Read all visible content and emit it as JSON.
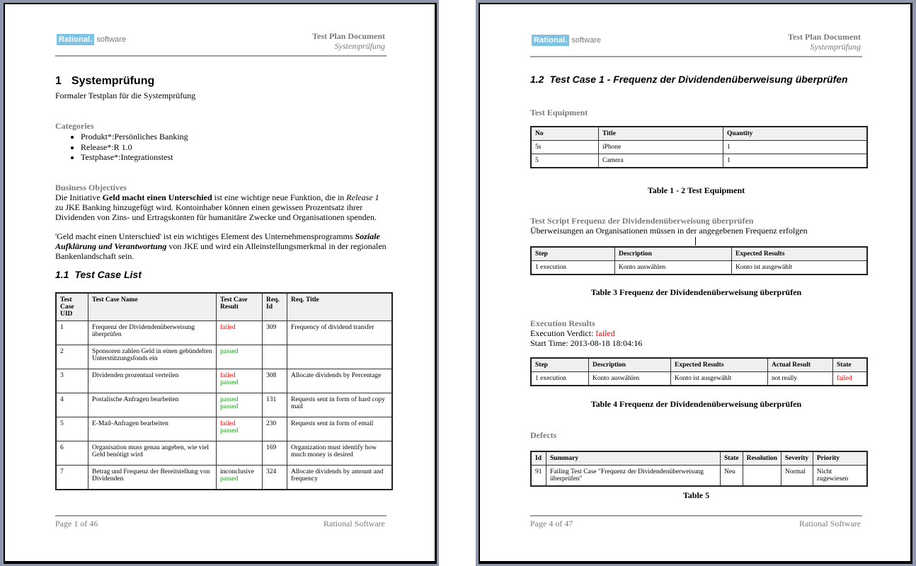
{
  "pages": [
    {
      "header": {
        "logo_brand": "Rational.",
        "logo_product": "software",
        "title": "Test Plan Document",
        "subtitle": "Systemprüfung"
      },
      "heading": {
        "number": "1",
        "title": "Systemprüfung"
      },
      "intro": "Formaler Testplan für die Systemprüfung",
      "categories": {
        "label": "Categories",
        "items": [
          "Produkt*:Persönliches Banking",
          "Release*:R 1.0",
          "Testphase*:Integrationstest"
        ]
      },
      "business_objectives": {
        "label": "Business Objectives",
        "p1_a": "Die Initiative ",
        "p1_bold": "Geld macht einen Unterschied",
        "p1_b": " ist eine wichtige neue Funktion, die in ",
        "p1_italic": "Release 1",
        "p1_c": " zu JKE Banking hinzugefügt wird. Kontoinhaber können einen gewissen Prozentsatz ihrer Dividenden von Zins- und Ertragskonten für humanitäre Zwecke und Organisationen spenden.",
        "p2_a": "'Geld macht einen Unterschied' ist ein wichtiges Element des Unternehmensprogramms ",
        "p2_bi": "Soziale Aufklärung und Verantwortung",
        "p2_b": " von JKE und wird ein Alleinstellungsmerkmal in der regionalen Bankenlandschaft sein."
      },
      "test_case_list": {
        "number": "1.1",
        "title": "Test Case List",
        "columns": [
          "Test Case UID",
          "Test Case Name",
          "Test Case Result",
          "Req. Id",
          "Req. Title"
        ],
        "rows": [
          {
            "uid": "1",
            "name": "Frequenz der Dividendenüberweisung überprüfen",
            "results": [
              {
                "text": "failed",
                "status": "failed"
              }
            ],
            "req_id": "309",
            "req_title": "Frequency of dividend transfer"
          },
          {
            "uid": "2",
            "name": "Sponsoren zahlen Geld in einen gebündelten Unterstützungsfonds ein",
            "results": [
              {
                "text": "passed",
                "status": "passed"
              }
            ],
            "req_id": "",
            "req_title": ""
          },
          {
            "uid": "3",
            "name": "Dividenden prozentual verteilen",
            "results": [
              {
                "text": "failed",
                "status": "failed"
              },
              {
                "text": "passed",
                "status": "passed"
              }
            ],
            "req_id": "308",
            "req_title": "Allocate dividends by Percentage"
          },
          {
            "uid": "4",
            "name": "Postalische Anfragen bearbeiten",
            "results": [
              {
                "text": "passed",
                "status": "passed"
              },
              {
                "text": "passed",
                "status": "passed"
              }
            ],
            "req_id": "131",
            "req_title": "Requests sent in form of hard copy mail"
          },
          {
            "uid": "5",
            "name": "E-Mail-Anfragen bearbeiten",
            "results": [
              {
                "text": "failed",
                "status": "failed"
              },
              {
                "text": "passed",
                "status": "passed"
              }
            ],
            "req_id": "230",
            "req_title": "Requests sent in form of email"
          },
          {
            "uid": "6",
            "name": "Organisation muss genau angeben, wie viel Geld benötigt wird",
            "results": [],
            "req_id": "169",
            "req_title": "Organization must identify how much money is desired"
          },
          {
            "uid": "7",
            "name": "Betrag und Frequenz der Bereitstellung von Dividenden",
            "results": [
              {
                "text": "inconclusive",
                "status": "inconclusive"
              },
              {
                "text": "passed",
                "status": "passed"
              }
            ],
            "req_id": "324",
            "req_title": "Allocate dividends by amount and frequency"
          }
        ]
      },
      "footer": {
        "page": "Page 1 of  46",
        "company": "Rational Software"
      }
    },
    {
      "header": {
        "logo_brand": "Rational.",
        "logo_product": "software",
        "title": "Test Plan Document",
        "subtitle": "Systemprüfung"
      },
      "heading": {
        "number": "1.2",
        "title": "Test Case 1 - Frequenz der Dividendenüberweisung überprüfen"
      },
      "test_equipment": {
        "label": "Test Equipment",
        "columns": [
          "No",
          "Title",
          "Quantity"
        ],
        "rows": [
          [
            "5s",
            "iPhone",
            "1"
          ],
          [
            "5",
            "Camera",
            "1"
          ]
        ],
        "caption": "Table 1 - 2 Test Equipment"
      },
      "test_script": {
        "label": "Test Script Frequenz der Dividendenüberweisung überprüfen",
        "description": "Überweisungen an Organisationen müssen in der angegebenen Frequenz erfolgen",
        "columns": [
          "Step",
          "Description",
          "Expected Results"
        ],
        "rows": [
          [
            "1 execution",
            "Konto auswählen",
            "Konto ist ausgewählt"
          ]
        ],
        "caption": "Table 3 Frequenz der Dividendenüberweisung überprüfen"
      },
      "execution_results": {
        "label": "Execution Results",
        "verdict_label": "Execution Verdict: ",
        "verdict": "failed",
        "start_time": "Start Time: 2013-08-18 18:04:16",
        "columns": [
          "Step",
          "Description",
          "Expected Results",
          "Actual Result",
          "State"
        ],
        "rows": [
          {
            "step": "1 execution",
            "description": "Konto auswählen",
            "expected": "Konto ist ausgewählt",
            "actual": "not really",
            "state": "failed"
          }
        ],
        "caption": "Table 4 Frequenz der Dividendenüberweisung überprüfen"
      },
      "defects": {
        "label": "Defects",
        "columns": [
          "Id",
          "Summary",
          "State",
          "Resolution",
          "Severity",
          "Priority"
        ],
        "rows": [
          [
            "91",
            "Failing Test Case \"Frequenz der Dividendenüberweisung überprüfen\"",
            "Neu",
            "",
            "Normal",
            "Nicht zugewiesen"
          ]
        ],
        "caption": "Table 5"
      },
      "footer": {
        "page": "Page 4 of  47",
        "company": "Rational Software"
      }
    }
  ],
  "colors": {
    "failed": "#ff0000",
    "passed": "#1a9a1a",
    "section_gray": "#7a7a7a",
    "logo_blue": "#7ec3e3",
    "frame": "#8e97ad"
  }
}
